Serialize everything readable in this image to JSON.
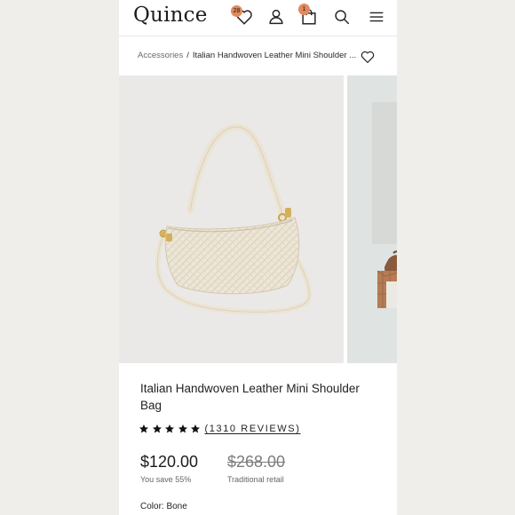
{
  "header": {
    "logo": "Quince",
    "wishlist_count": "28",
    "cart_count": "1",
    "icons": [
      "heart-icon",
      "account-icon",
      "bag-icon",
      "search-icon",
      "menu-icon"
    ]
  },
  "breadcrumb": {
    "parent": "Accessories",
    "separator": "/",
    "current": "Italian Handwoven Leather Mini Shoulder ..."
  },
  "product": {
    "title": "Italian Handwoven Leather Mini Shoulder Bag",
    "rating": 5,
    "reviews": "(1310 REVIEWS)",
    "price": "$120.00",
    "savings": "You save 55%",
    "retail_price": "$268.00",
    "retail_label": "Traditional retail",
    "color_label": "Color: Bone"
  },
  "colors": {
    "badge": "#e2895e",
    "text": "#1c1c1c",
    "bag": "#ede6d6"
  }
}
